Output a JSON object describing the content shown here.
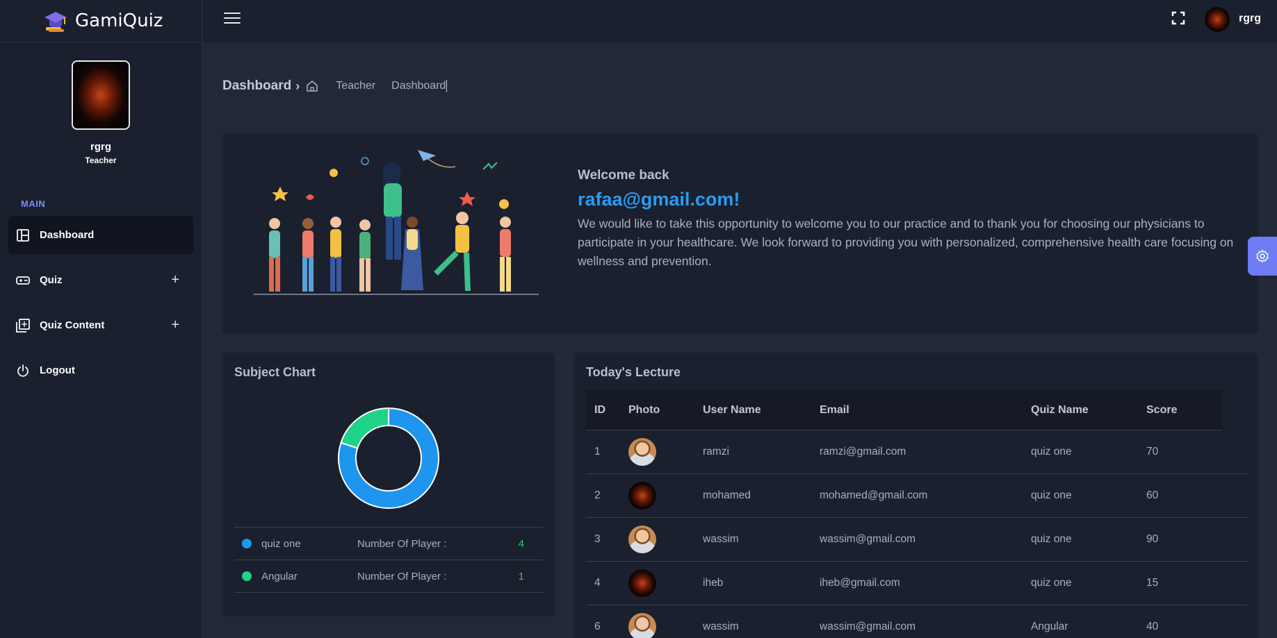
{
  "brand": {
    "name": "GamiQuiz"
  },
  "profile": {
    "name": "rgrg",
    "role": "Teacher"
  },
  "sidebar": {
    "section": "MAIN",
    "items": [
      {
        "label": "Dashboard",
        "icon": "dashboard-icon",
        "active": true
      },
      {
        "label": "Quiz",
        "icon": "gamepad-icon",
        "expand": "+"
      },
      {
        "label": "Quiz Content",
        "icon": "library-icon",
        "expand": "+"
      },
      {
        "label": "Logout",
        "icon": "power-icon"
      }
    ]
  },
  "topbar": {
    "user": "rgrg"
  },
  "breadcrumb": {
    "title": "Dashboard",
    "chevron": "›",
    "link": "Teacher",
    "current": "Dashboard"
  },
  "welcome": {
    "greeting": "Welcome back",
    "email": "rafaa@gmail.com!",
    "message": "We would like to take this opportunity to welcome you to our practice and to thank you for choosing our physicians to participate in your healthcare. We look forward to providing you with personalized, comprehensive health care focusing on wellness and prevention."
  },
  "subject_chart": {
    "title": "Subject Chart",
    "legend_label": "Number Of Player :",
    "colors": {
      "accent_blue": "#1e96f0",
      "accent_green": "#1fd38a"
    }
  },
  "chart_data": {
    "type": "pie",
    "categories": [
      "quiz one",
      "Angular"
    ],
    "values": [
      4,
      1
    ],
    "colors": [
      "#1e96f0",
      "#1fd38a"
    ],
    "donut": true
  },
  "lecture": {
    "title": "Today's Lecture",
    "columns": [
      "ID",
      "Photo",
      "User Name",
      "Email",
      "Quiz Name",
      "Score"
    ],
    "rows": [
      {
        "id": "1",
        "photo": "man",
        "user": "ramzi",
        "email": "ramzi@gmail.com",
        "quiz": "quiz one",
        "score": "70"
      },
      {
        "id": "2",
        "photo": "fire",
        "user": "mohamed",
        "email": "mohamed@gmail.com",
        "quiz": "quiz one",
        "score": "60"
      },
      {
        "id": "3",
        "photo": "man",
        "user": "wassim",
        "email": "wassim@gmail.com",
        "quiz": "quiz one",
        "score": "90"
      },
      {
        "id": "4",
        "photo": "fire",
        "user": "iheb",
        "email": "iheb@gmail.com",
        "quiz": "quiz one",
        "score": "15"
      },
      {
        "id": "6",
        "photo": "man",
        "user": "wassim",
        "email": "wassim@gmail.com",
        "quiz": "Angular",
        "score": "40"
      }
    ]
  }
}
